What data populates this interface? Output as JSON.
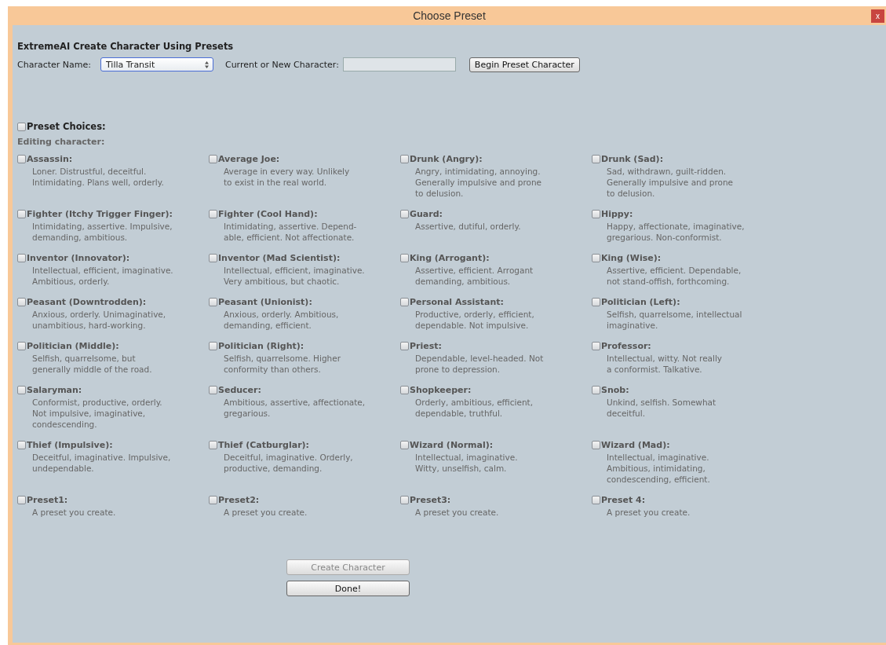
{
  "window": {
    "title": "Choose Preset",
    "close_label": "x"
  },
  "heading": "ExtremeAI Create Character Using Presets",
  "character_name": {
    "label": "Character Name:",
    "value": "Tilla Transit"
  },
  "current_character": {
    "label": "Current or New Character:"
  },
  "begin_button": "Begin Preset Character",
  "preset_choices": {
    "label": "Preset Choices:",
    "checked": false
  },
  "editing_label": "Editing character:",
  "presets": [
    {
      "name": "Assassin:",
      "description": "Loner. Distrustful, deceitful.\nIntimidating. Plans well, orderly.",
      "checked": false
    },
    {
      "name": "Average Joe:",
      "description": "Average in every way. Unlikely\nto exist in the real world.",
      "checked": false
    },
    {
      "name": "Drunk (Angry):",
      "description": "Angry, intimidating, annoying.\nGenerally impulsive and prone\nto delusion.",
      "checked": false
    },
    {
      "name": "Drunk (Sad):",
      "description": "Sad, withdrawn, guilt-ridden.\nGenerally impulsive and prone\nto delusion.",
      "checked": false
    },
    {
      "name": "Fighter (Itchy Trigger Finger):",
      "description": "Intimidating, assertive. Impulsive,\ndemanding, ambitious.",
      "checked": false
    },
    {
      "name": "Fighter (Cool Hand):",
      "description": "Intimidating, assertive. Depend-\nable, efficient. Not affectionate.",
      "checked": false
    },
    {
      "name": "Guard:",
      "description": "Assertive, dutiful, orderly.",
      "checked": false
    },
    {
      "name": "Hippy:",
      "description": "Happy, affectionate, imaginative,\ngregarious. Non-conformist.",
      "checked": false
    },
    {
      "name": "Inventor (Innovator):",
      "description": "Intellectual, efficient, imaginative.\nAmbitious, orderly.",
      "checked": false
    },
    {
      "name": "Inventor (Mad Scientist):",
      "description": "Intellectual, efficient, imaginative.\nVery ambitious, but chaotic.",
      "checked": false
    },
    {
      "name": "King (Arrogant):",
      "description": "Assertive, efficient. Arrogant\ndemanding, ambitious.",
      "checked": false
    },
    {
      "name": "King (Wise):",
      "description": "Assertive, efficient. Dependable,\nnot stand-offish, forthcoming.",
      "checked": false
    },
    {
      "name": "Peasant (Downtrodden):",
      "description": "Anxious, orderly. Unimaginative,\nunambitious, hard-working.",
      "checked": false
    },
    {
      "name": "Peasant (Unionist):",
      "description": "Anxious, orderly. Ambitious,\ndemanding, efficient.",
      "checked": false
    },
    {
      "name": "Personal Assistant:",
      "description": "Productive, orderly, efficient,\ndependable. Not impulsive.",
      "checked": false
    },
    {
      "name": "Politician (Left):",
      "description": "Selfish, quarrelsome, intellectual\nimaginative.",
      "checked": false
    },
    {
      "name": "Politician (Middle):",
      "description": "Selfish, quarrelsome, but\ngenerally middle of the road.",
      "checked": false
    },
    {
      "name": "Politician (Right):",
      "description": "Selfish, quarrelsome. Higher\nconformity than others.",
      "checked": false
    },
    {
      "name": "Priest:",
      "description": "Dependable, level-headed. Not\nprone to depression.",
      "checked": false
    },
    {
      "name": "Professor:",
      "description": "Intellectual, witty. Not really\na conformist. Talkative.",
      "checked": false
    },
    {
      "name": "Salaryman:",
      "description": "Conformist, productive, orderly.\nNot impulsive, imaginative,\ncondescending.",
      "checked": false
    },
    {
      "name": "Seducer:",
      "description": "Ambitious, assertive, affectionate,\ngregarious.",
      "checked": false
    },
    {
      "name": "Shopkeeper:",
      "description": "Orderly, ambitious, efficient,\ndependable, truthful.",
      "checked": false
    },
    {
      "name": "Snob:",
      "description": "Unkind, selfish. Somewhat\ndeceitful.",
      "checked": false
    },
    {
      "name": "Thief (Impulsive):",
      "description": "Deceitful, imaginative. Impulsive,\nundependable.",
      "checked": false
    },
    {
      "name": "Thief (Catburglar):",
      "description": "Deceitful, imaginative. Orderly,\nproductive, demanding.",
      "checked": false
    },
    {
      "name": "Wizard (Normal):",
      "description": "Intellectual, imaginative.\nWitty, unselfish, calm.",
      "checked": false
    },
    {
      "name": "Wizard (Mad):",
      "description": "Intellectual, imaginative.\nAmbitious, intimidating,\ncondescending, efficient.",
      "checked": false
    },
    {
      "name": "Preset1:",
      "description": "A preset you create.",
      "checked": false
    },
    {
      "name": "Preset2:",
      "description": "A preset you create.",
      "checked": false
    },
    {
      "name": "Preset3:",
      "description": "A preset you create.",
      "checked": false
    },
    {
      "name": "Preset 4:",
      "description": "A preset you create.",
      "checked": false
    }
  ],
  "buttons": [
    {
      "label": "Create Character",
      "disabled": true
    },
    {
      "label": "Done!",
      "disabled": false
    }
  ]
}
